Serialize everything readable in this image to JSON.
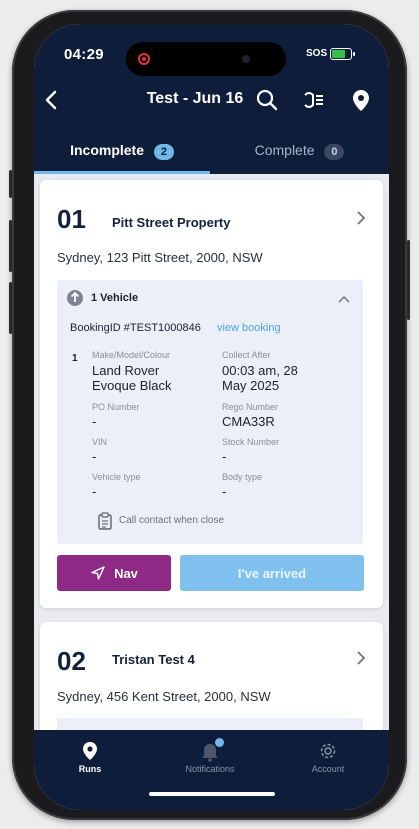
{
  "status": {
    "time": "04:29",
    "sos": "SOS"
  },
  "header": {
    "title": "Test - Jun 16"
  },
  "tabs": [
    {
      "label": "Incomplete",
      "count": "2"
    },
    {
      "label": "Complete",
      "count": "0"
    }
  ],
  "cards": [
    {
      "number": "01",
      "name": "Pitt Street Property",
      "address": "Sydney, 123 Pitt Street, 2000, NSW",
      "vehicles_label": "1 Vehicle",
      "booking_prefix": "BookingID #TEST1000846",
      "view_booking": "view booking",
      "vehicle_index": "1",
      "fields": {
        "make_label": "Make/Model/Colour",
        "make_line1": "Land Rover",
        "make_line2": "Evoque Black",
        "collect_label": "Collect After",
        "collect_line1": "00:03 am, 28",
        "collect_line2": "May 2025",
        "po_label": "PO Number",
        "po_value": "-",
        "rego_label": "Rego Number",
        "rego_value": "CMA33R",
        "vin_label": "VIN",
        "vin_value": "-",
        "stock_label": "Stock Number",
        "stock_value": "-",
        "vtype_label": "Vehicle type",
        "vtype_value": "-",
        "btype_label": "Body type",
        "btype_value": "-"
      },
      "note": "Call contact when close",
      "nav_label": "Nav",
      "arrived_label": "I've arrived"
    },
    {
      "number": "02",
      "name": "Tristan Test 4",
      "address": "Sydney, 456 Kent Street, 2000, NSW"
    }
  ],
  "bottom_nav": [
    {
      "label": "Runs",
      "icon": "location-pin-icon"
    },
    {
      "label": "Notifications",
      "icon": "bell-icon"
    },
    {
      "label": "Account",
      "icon": "gear-icon"
    }
  ],
  "colors": {
    "navy": "#0e1d3a",
    "accent_blue": "#6fb8e8",
    "nav_button": "#8e2a86",
    "arrived_button": "#7fc0ee",
    "battery_green": "#36c24a"
  }
}
